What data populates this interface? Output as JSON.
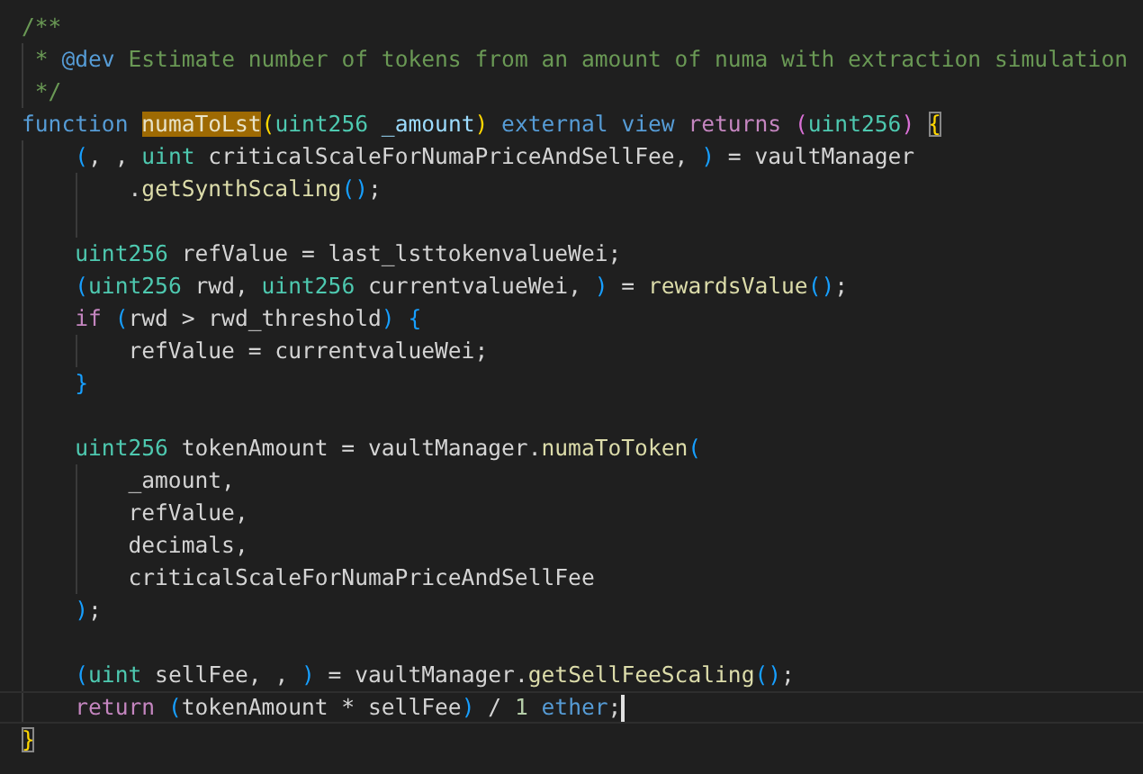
{
  "editor": {
    "lines": [
      {
        "tokens": [
          {
            "text": "/**",
            "kind": "comment"
          }
        ]
      },
      {
        "tokens": [
          {
            "text": " * ",
            "kind": "comment"
          },
          {
            "text": "@dev",
            "kind": "tag"
          },
          {
            "text": " Estimate number of tokens from an amount of numa with extraction simulation",
            "kind": "comment"
          }
        ]
      },
      {
        "tokens": [
          {
            "text": " */",
            "kind": "comment"
          }
        ]
      },
      {
        "tokens": [
          {
            "text": "function ",
            "kind": "keyword"
          },
          {
            "text": "numaToLst",
            "kind": "function",
            "match": true
          },
          {
            "text": "(",
            "kind": "bracket1"
          },
          {
            "text": "uint256 ",
            "kind": "type"
          },
          {
            "text": "_amount",
            "kind": "variable"
          },
          {
            "text": ")",
            "kind": "bracket1"
          },
          {
            "text": " external view ",
            "kind": "keyword"
          },
          {
            "text": "returns ",
            "kind": "control"
          },
          {
            "text": "(",
            "kind": "bracket2"
          },
          {
            "text": "uint256",
            "kind": "type"
          },
          {
            "text": ")",
            "kind": "bracket2"
          },
          {
            "text": " {",
            "kind": "bracket1",
            "match_box": true
          }
        ]
      },
      {
        "tokens": [
          {
            "text": "    (",
            "kind": "bracket3"
          },
          {
            "text": ", , ",
            "kind": "plain"
          },
          {
            "text": "uint",
            "kind": "type"
          },
          {
            "text": " criticalScaleForNumaPriceAndSellFee, ",
            "kind": "plain"
          },
          {
            "text": ")",
            "kind": "bracket3"
          },
          {
            "text": " = vaultManager",
            "kind": "plain"
          }
        ]
      },
      {
        "blank_after": true,
        "tokens": [
          {
            "text": "        .",
            "kind": "plain"
          },
          {
            "text": "getSynthScaling",
            "kind": "function"
          },
          {
            "text": "()",
            "kind": "bracket3"
          },
          {
            "text": ";",
            "kind": "plain"
          }
        ]
      },
      {
        "tokens": [
          {
            "text": "    uint256",
            "kind": "type"
          },
          {
            "text": " refValue = last_lsttokenvalueWei;",
            "kind": "plain"
          }
        ]
      },
      {
        "tokens": [
          {
            "text": "    (",
            "kind": "bracket3"
          },
          {
            "text": "uint256",
            "kind": "type"
          },
          {
            "text": " rwd, ",
            "kind": "plain"
          },
          {
            "text": "uint256",
            "kind": "type"
          },
          {
            "text": " currentvalueWei, ",
            "kind": "plain"
          },
          {
            "text": ")",
            "kind": "bracket3"
          },
          {
            "text": " = ",
            "kind": "plain"
          },
          {
            "text": "rewardsValue",
            "kind": "function"
          },
          {
            "text": "()",
            "kind": "bracket3"
          },
          {
            "text": ";",
            "kind": "plain"
          }
        ]
      },
      {
        "tokens": [
          {
            "text": "    if ",
            "kind": "control"
          },
          {
            "text": "(",
            "kind": "bracket3"
          },
          {
            "text": "rwd > rwd_threshold",
            "kind": "plain"
          },
          {
            "text": ")",
            "kind": "bracket3"
          },
          {
            "text": " {",
            "kind": "bracket3"
          }
        ]
      },
      {
        "tokens": [
          {
            "text": "        refValue = currentvalueWei;",
            "kind": "plain"
          }
        ]
      },
      {
        "blank_after": true,
        "tokens": [
          {
            "text": "    }",
            "kind": "bracket3"
          }
        ]
      },
      {
        "tokens": [
          {
            "text": "    uint256",
            "kind": "type"
          },
          {
            "text": " tokenAmount = vaultManager.",
            "kind": "plain"
          },
          {
            "text": "numaToToken",
            "kind": "function"
          },
          {
            "text": "(",
            "kind": "bracket3"
          }
        ]
      },
      {
        "tokens": [
          {
            "text": "        _amount,",
            "kind": "plain"
          }
        ]
      },
      {
        "tokens": [
          {
            "text": "        refValue,",
            "kind": "plain"
          }
        ]
      },
      {
        "tokens": [
          {
            "text": "        decimals,",
            "kind": "plain"
          }
        ]
      },
      {
        "tokens": [
          {
            "text": "        criticalScaleForNumaPriceAndSellFee",
            "kind": "plain"
          }
        ]
      },
      {
        "blank_after": true,
        "tokens": [
          {
            "text": "    )",
            "kind": "bracket3"
          },
          {
            "text": ";",
            "kind": "plain"
          }
        ]
      },
      {
        "tokens": [
          {
            "text": "    (",
            "kind": "bracket3"
          },
          {
            "text": "uint",
            "kind": "type"
          },
          {
            "text": " sellFee, , ",
            "kind": "plain"
          },
          {
            "text": ")",
            "kind": "bracket3"
          },
          {
            "text": " = vaultManager.",
            "kind": "plain"
          },
          {
            "text": "getSellFeeScaling",
            "kind": "function"
          },
          {
            "text": "()",
            "kind": "bracket3"
          },
          {
            "text": ";",
            "kind": "plain"
          }
        ]
      },
      {
        "current": true,
        "cursor": true,
        "tokens": [
          {
            "text": "    return ",
            "kind": "control"
          },
          {
            "text": "(",
            "kind": "bracket3"
          },
          {
            "text": "tokenAmount * sellFee",
            "kind": "plain"
          },
          {
            "text": ")",
            "kind": "bracket3"
          },
          {
            "text": " / ",
            "kind": "plain"
          },
          {
            "text": "1",
            "kind": "number"
          },
          {
            "text": " ether",
            "kind": "keyword"
          },
          {
            "text": ";",
            "kind": "plain"
          }
        ]
      },
      {
        "tokens": [
          {
            "text": "}",
            "kind": "bracket1",
            "match_box": true
          }
        ]
      }
    ]
  }
}
